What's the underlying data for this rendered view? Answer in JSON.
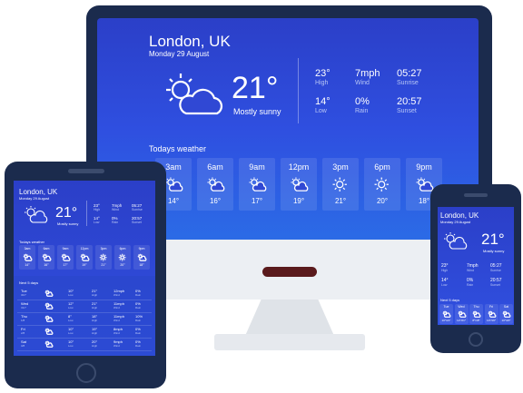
{
  "city": "London, UK",
  "date": "Monday 29 August",
  "current": {
    "temp": "21°",
    "condition": "Mostly sunny",
    "icon": "partly-cloudy-icon"
  },
  "stats": [
    {
      "value": "23°",
      "label": "High"
    },
    {
      "value": "7mph",
      "label": "Wind"
    },
    {
      "value": "05:27",
      "label": "Sunrise"
    },
    {
      "value": "14°",
      "label": "Low"
    },
    {
      "value": "0%",
      "label": "Rain"
    },
    {
      "value": "20:57",
      "label": "Sunset"
    }
  ],
  "todays_label": "Todays weather",
  "hourly": [
    {
      "time": "3am",
      "temp": "14°",
      "icon": "partly-cloudy-icon"
    },
    {
      "time": "6am",
      "temp": "16°",
      "icon": "partly-cloudy-icon"
    },
    {
      "time": "9am",
      "temp": "17°",
      "icon": "partly-cloudy-icon"
    },
    {
      "time": "12pm",
      "temp": "19°",
      "icon": "partly-cloudy-icon"
    },
    {
      "time": "3pm",
      "temp": "21°",
      "icon": "sun-icon"
    },
    {
      "time": "6pm",
      "temp": "20°",
      "icon": "sun-icon"
    },
    {
      "time": "9pm",
      "temp": "18°",
      "icon": "partly-cloudy-icon"
    }
  ],
  "next5_label": "Next 5 days",
  "days": [
    {
      "day": "Tue",
      "date": "30/7",
      "low": "10°",
      "high": "21°",
      "wind": "12mph",
      "rain": "0%"
    },
    {
      "day": "Wed",
      "date": "31/7",
      "low": "12°",
      "high": "21°",
      "wind": "11mph",
      "rain": "0%"
    },
    {
      "day": "Thu",
      "date": "1/8",
      "low": "8°",
      "high": "18°",
      "wind": "11mph",
      "rain": "10%"
    },
    {
      "day": "Fri",
      "date": "2/8",
      "low": "10°",
      "high": "19°",
      "wind": "8mph",
      "rain": "0%"
    },
    {
      "day": "Sat",
      "date": "3/8",
      "low": "10°",
      "high": "20°",
      "wind": "9mph",
      "rain": "0%"
    }
  ],
  "colors": {
    "bg_top": "#2b3fc8",
    "bg_bottom": "#2b6be6",
    "frame": "#1b2b4d"
  }
}
